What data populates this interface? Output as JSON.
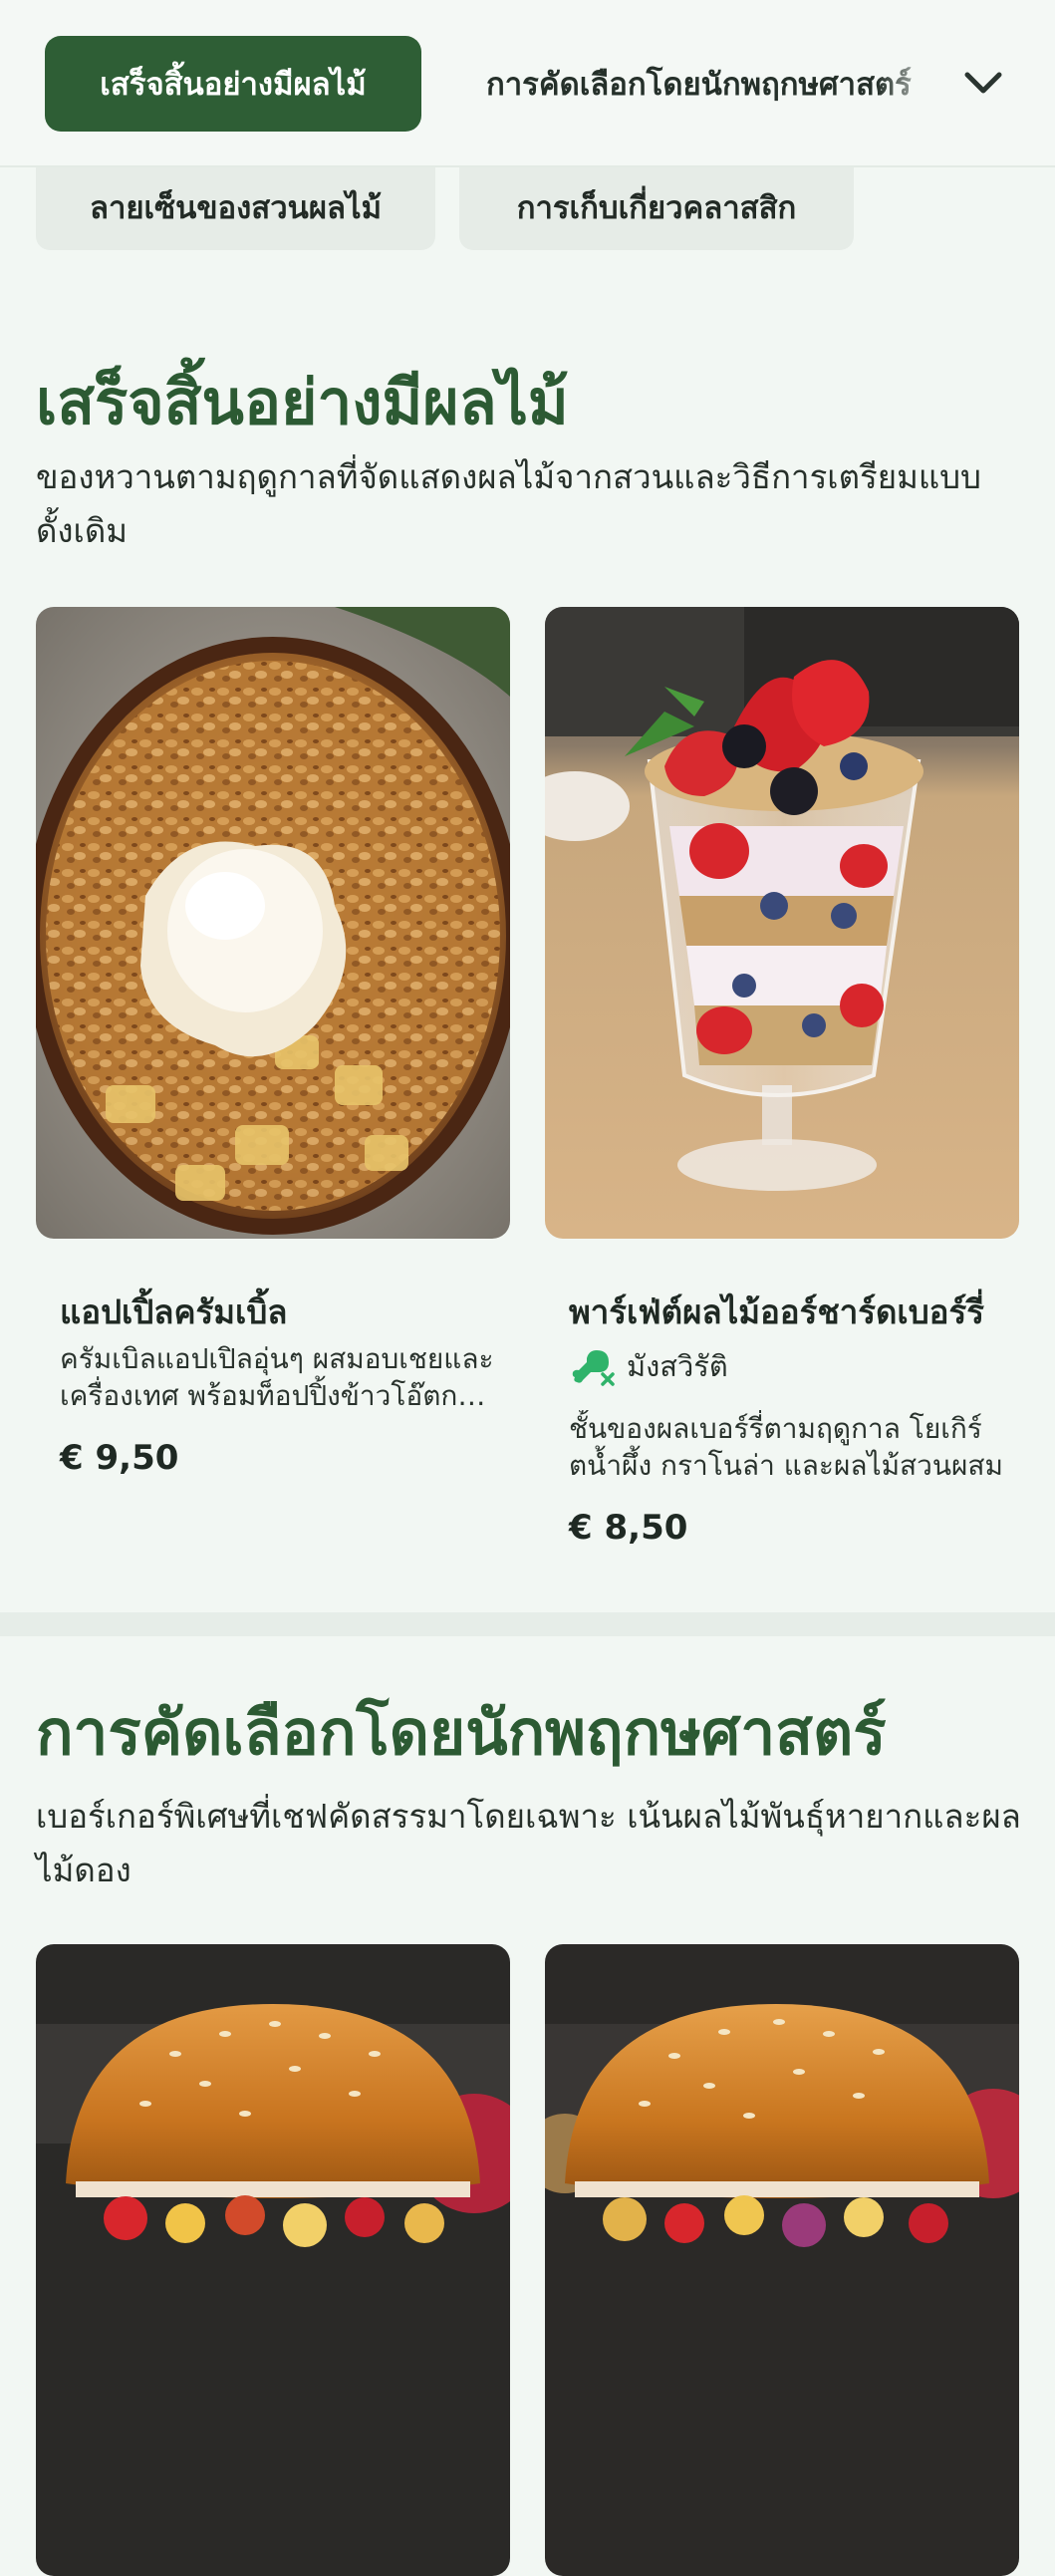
{
  "nav": {
    "tabs": [
      {
        "label": "เสร็จสิ้นอย่างมีผลไม้",
        "active": true
      },
      {
        "label": "การคัดเลือกโดยนักพฤกษศาสตร์",
        "active": false
      }
    ],
    "expand_icon": "chevron-down-icon"
  },
  "chips": [
    {
      "label": "ลายเซ็นของสวนผลไม้"
    },
    {
      "label": "การเก็บเกี่ยวคลาสสิก"
    }
  ],
  "sections": [
    {
      "title": "เสร็จสิ้นอย่างมีผลไม้",
      "description": "ของหวานตามฤดูกาลที่จัดแสดงผลไม้จากสวนและวิธีการเตรียมแบบดั้งเดิม",
      "items": [
        {
          "name": "แอปเปิ้ลครัมเบิ้ล",
          "description": "ครัมเบิลแอปเปิลอุ่นๆ ผสมอบเชยและเครื่องเทศ พร้อมท็อปปิ้งข้าวโอ๊ตกรอบ",
          "price": "€ 9,50",
          "tag": null,
          "image": "apple-crumble-with-ice-cream"
        },
        {
          "name": "พาร์เฟ่ต์ผลไม้ออร์ชาร์ดเบอร์รี่",
          "description": "ชั้นของผลเบอร์รี่ตามฤดูกาล โยเกิร์ตน้ำผึ้ง กราโนล่า และผลไม้สวนผสม",
          "price": "€ 8,50",
          "tag": {
            "label": "มังสวิรัติ",
            "icon": "vegetarian-drumstick-crossed-icon",
            "color": "#2fb36a"
          },
          "image": "berry-parfait-glass"
        }
      ]
    },
    {
      "title": "การคัดเลือกโดยนักพฤกษศาสตร์",
      "description": "เบอร์เกอร์พิเศษที่เชฟคัดสรรมาโดยเฉพาะ เน้นผลไม้พันธุ์หายากและผลไม้ดอง",
      "items": [
        {
          "image": "fruit-burger"
        },
        {
          "image": "fruit-burger"
        }
      ]
    }
  ],
  "colors": {
    "brand_green": "#2e5e35",
    "heading_green": "#2c5a33",
    "background": "#f2f7f3",
    "tag_green": "#2fb36a"
  }
}
